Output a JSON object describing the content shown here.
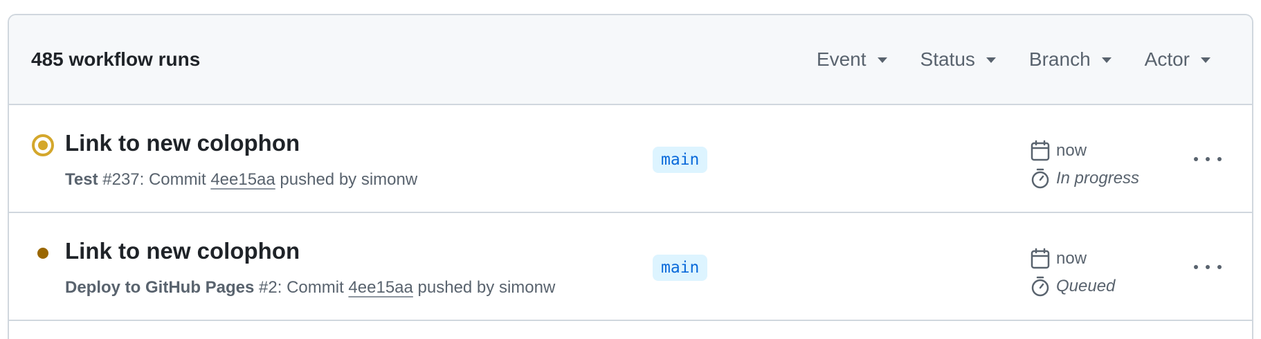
{
  "header": {
    "run_count": "485 workflow runs",
    "filters": [
      {
        "label": "Event"
      },
      {
        "label": "Status"
      },
      {
        "label": "Branch"
      },
      {
        "label": "Actor"
      }
    ]
  },
  "runs": [
    {
      "status": "in-progress",
      "status_color": "#d4a72c",
      "title": "Link to new colophon",
      "workflow": "Test",
      "run_number": "#237",
      "commit_prefix": ": Commit ",
      "sha": "4ee15aa",
      "pushed_by": " pushed by simonw",
      "branch": "main",
      "time": "now",
      "state": "In progress"
    },
    {
      "status": "queued",
      "status_color": "#9a6700",
      "title": "Link to new colophon",
      "workflow": "Deploy to GitHub Pages",
      "run_number": "#2",
      "commit_prefix": ": Commit ",
      "sha": "4ee15aa",
      "pushed_by": " pushed by simonw",
      "branch": "main",
      "time": "now",
      "state": "Queued"
    }
  ],
  "colors": {
    "header_bg": "#f6f8fa",
    "border": "#d0d7de",
    "muted_text": "#59636e",
    "branch_bg": "#ddf4ff",
    "branch_text": "#0969da"
  }
}
